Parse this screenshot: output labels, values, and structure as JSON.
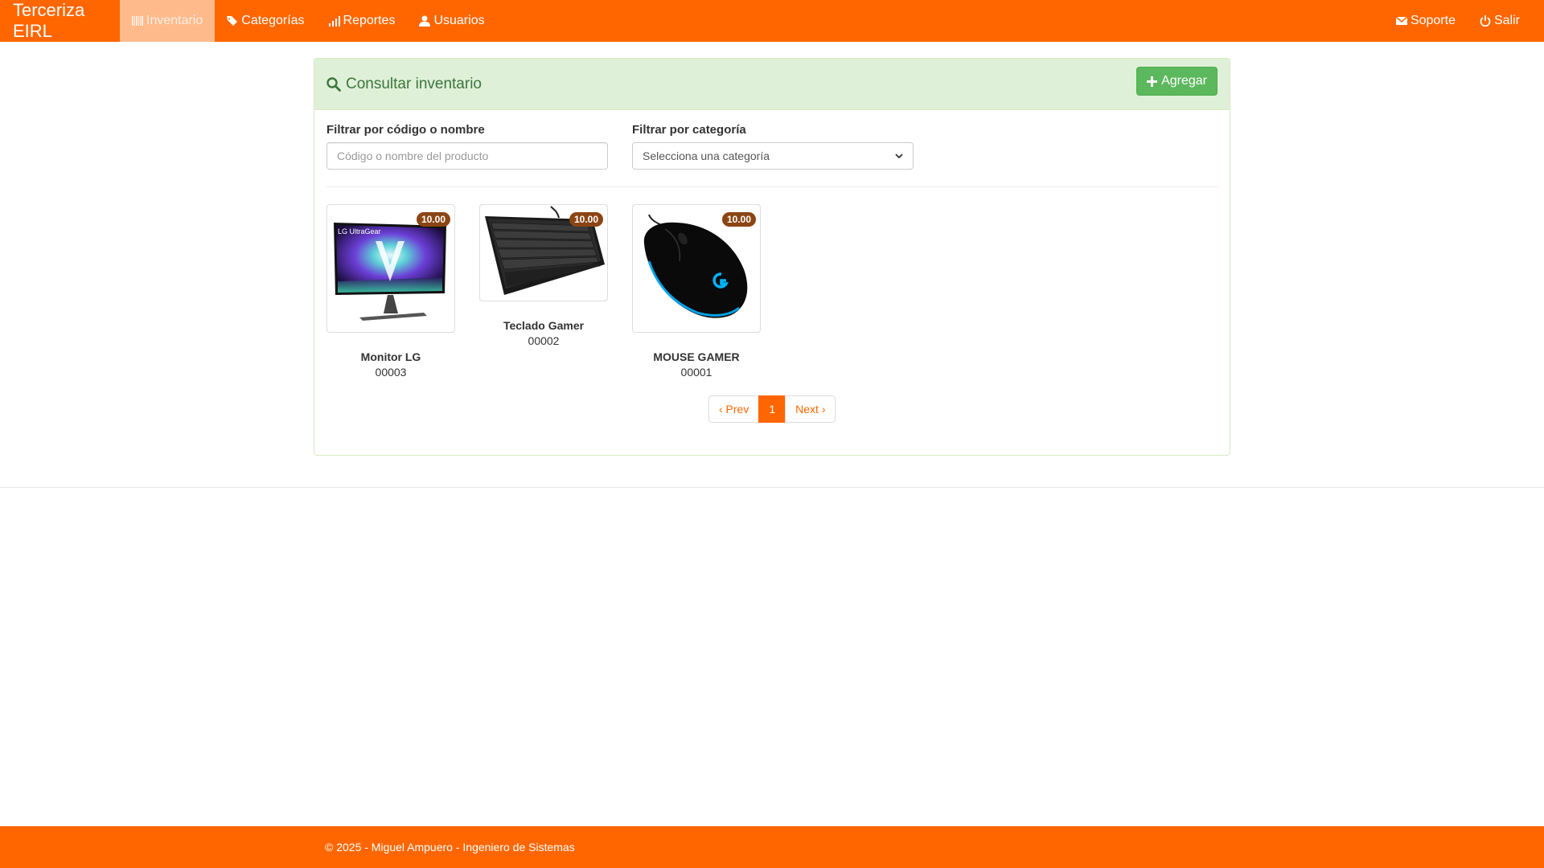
{
  "navbar": {
    "brand": "Terceriza EIRL",
    "items": [
      {
        "label": "Inventario",
        "icon": "barcode-icon",
        "active": true
      },
      {
        "label": "Categorías",
        "icon": "tags-icon"
      },
      {
        "label": "Reportes",
        "icon": "signal-icon"
      },
      {
        "label": "Usuarios",
        "icon": "user-icon"
      }
    ],
    "right_items": [
      {
        "label": "Soporte",
        "icon": "envelope-icon"
      },
      {
        "label": "Salir",
        "icon": "power-icon"
      }
    ]
  },
  "panel": {
    "title": "Consultar inventario",
    "add_label": "Agregar"
  },
  "filters": {
    "code_label": "Filtrar por código o nombre",
    "code_placeholder": "Código o nombre del producto",
    "code_value": "",
    "category_label": "Filtrar por categoría",
    "category_selected": "Selecciona una categoría"
  },
  "products": [
    {
      "name": "Monitor LG",
      "code": "00003",
      "price": "10.00",
      "image": "monitor-image",
      "logo_text": "LG UltraGear"
    },
    {
      "name": "Teclado Gamer",
      "code": "00002",
      "price": "10.00",
      "image": "keyboard-image"
    },
    {
      "name": "MOUSE GAMER",
      "code": "00001",
      "price": "10.00",
      "image": "mouse-image"
    }
  ],
  "pagination": {
    "prev": "‹ Prev",
    "current": "1",
    "next": "Next ›"
  },
  "footer": {
    "text": "© 2025 - Miguel Ampuero - Ingeniero de Sistemas"
  },
  "colors": {
    "brand": "#ff6600",
    "panel_heading_bg": "#dff0d8",
    "panel_title": "#3c763d",
    "success": "#5cb85c",
    "badge": "#8b4513"
  }
}
